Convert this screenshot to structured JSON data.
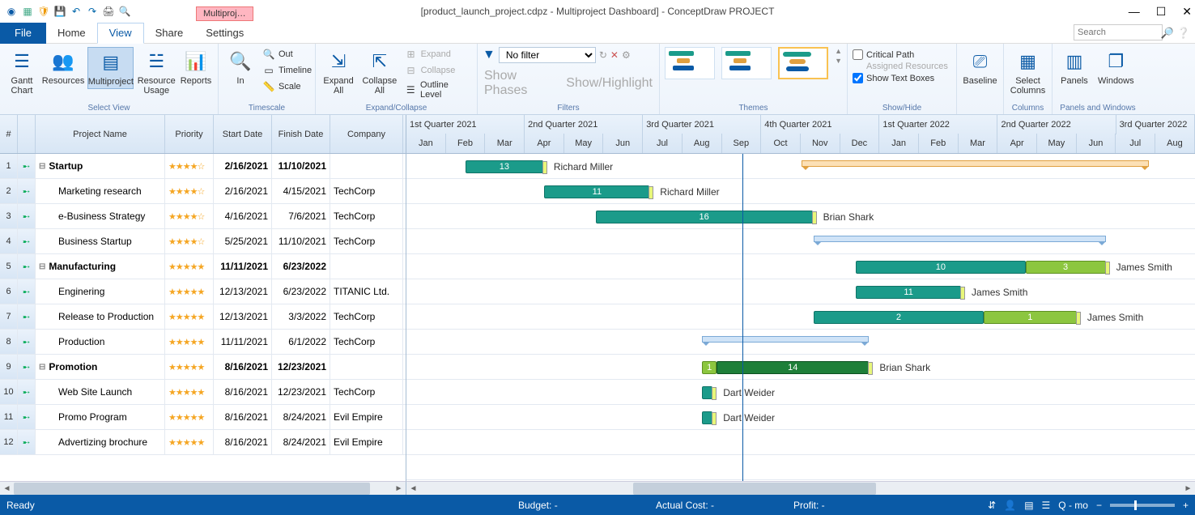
{
  "window": {
    "title": "[product_launch_project.cdpz - Multiproject Dashboard] - ConceptDraw PROJECT",
    "doc_tab": "Multiproj…"
  },
  "menu": {
    "file": "File",
    "home": "Home",
    "view": "View",
    "share": "Share",
    "settings": "Settings"
  },
  "search": {
    "placeholder": "Search"
  },
  "ribbon": {
    "groups": {
      "select_view": "Select View",
      "timescale": "Timescale",
      "expand_collapse": "Expand/Collapse",
      "filters": "Filters",
      "themes": "Themes",
      "show_hide": "Show/Hide",
      "columns": "Columns",
      "panels_windows": "Panels and Windows"
    },
    "buttons": {
      "gantt_chart": "Gantt\nChart",
      "resources": "Resources",
      "multiproject": "Multiproject",
      "resource_usage": "Resource\nUsage",
      "reports": "Reports",
      "in": "In",
      "out": "Out",
      "timeline": "Timeline",
      "scale": "Scale",
      "expand_all": "Expand\nAll",
      "collapse_all": "Collapse\nAll",
      "expand": "Expand",
      "collapse": "Collapse",
      "outline_level": "Outline Level",
      "no_filter": "No filter",
      "show_phases": "Show Phases",
      "show_highlight": "Show/Highlight",
      "critical_path": "Critical Path",
      "assigned_resources": "Assigned Resources",
      "show_text_boxes": "Show Text Boxes",
      "baseline": "Baseline",
      "select_columns": "Select\nColumns",
      "panels": "Panels",
      "windows": "Windows"
    }
  },
  "grid": {
    "headers": {
      "num": "#",
      "name": "Project Name",
      "priority": "Priority",
      "start": "Start Date",
      "finish": "Finish Date",
      "company": "Company"
    },
    "rows": [
      {
        "n": "1",
        "name": "Startup",
        "group": true,
        "indent": 0,
        "stars": 4,
        "start": "2/16/2021",
        "finish": "11/10/2021",
        "company": "",
        "bold": true
      },
      {
        "n": "2",
        "name": "Marketing research",
        "group": false,
        "indent": 1,
        "stars": 4,
        "start": "2/16/2021",
        "finish": "4/15/2021",
        "company": "TechCorp"
      },
      {
        "n": "3",
        "name": "e-Business Strategy",
        "group": false,
        "indent": 1,
        "stars": 4,
        "start": "4/16/2021",
        "finish": "7/6/2021",
        "company": "TechCorp"
      },
      {
        "n": "4",
        "name": "Business Startup",
        "group": false,
        "indent": 1,
        "stars": 4,
        "start": "5/25/2021",
        "finish": "11/10/2021",
        "company": "TechCorp"
      },
      {
        "n": "5",
        "name": "Manufacturing",
        "group": true,
        "indent": 0,
        "stars": 5,
        "start": "11/11/2021",
        "finish": "6/23/2022",
        "company": "",
        "bold": true
      },
      {
        "n": "6",
        "name": "Enginering",
        "group": false,
        "indent": 1,
        "stars": 5,
        "start": "12/13/2021",
        "finish": "6/23/2022",
        "company": "TITANIC Ltd."
      },
      {
        "n": "7",
        "name": "Release to Production",
        "group": false,
        "indent": 1,
        "stars": 5,
        "start": "12/13/2021",
        "finish": "3/3/2022",
        "company": "TechCorp"
      },
      {
        "n": "8",
        "name": "Production",
        "group": false,
        "indent": 1,
        "stars": 5,
        "start": "11/11/2021",
        "finish": "6/1/2022",
        "company": "TechCorp"
      },
      {
        "n": "9",
        "name": "Promotion",
        "group": true,
        "indent": 0,
        "stars": 5,
        "start": "8/16/2021",
        "finish": "12/23/2021",
        "company": "",
        "bold": true
      },
      {
        "n": "10",
        "name": "Web Site Launch",
        "group": false,
        "indent": 1,
        "stars": 5,
        "start": "8/16/2021",
        "finish": "12/23/2021",
        "company": "TechCorp"
      },
      {
        "n": "11",
        "name": "Promo Program",
        "group": false,
        "indent": 1,
        "stars": 5,
        "start": "8/16/2021",
        "finish": "8/24/2021",
        "company": "Evil Empire"
      },
      {
        "n": "12",
        "name": "Advertizing brochure",
        "group": false,
        "indent": 1,
        "stars": 5,
        "start": "8/16/2021",
        "finish": "8/24/2021",
        "company": "Evil Empire"
      }
    ]
  },
  "timeline": {
    "quarters": [
      "1st Quarter 2021",
      "2nd Quarter 2021",
      "3rd Quarter 2021",
      "4th Quarter 2021",
      "1st Quarter 2022",
      "2nd Quarter 2022",
      "3rd Quarter 2022"
    ],
    "months": [
      "Jan",
      "Feb",
      "Mar",
      "Apr",
      "May",
      "Jun",
      "Jul",
      "Aug",
      "Sep",
      "Oct",
      "Nov",
      "Dec",
      "Jan",
      "Feb",
      "Mar",
      "Apr",
      "May",
      "Jun",
      "Jul",
      "Aug"
    ]
  },
  "gantt_labels": {
    "r2": {
      "resource": "Richard Miller",
      "val": "13"
    },
    "r3": {
      "resource": "Richard Miller",
      "val": "11"
    },
    "r4": {
      "resource": "Brian Shark",
      "val": "16"
    },
    "r6": {
      "resource": "James Smith",
      "val1": "10",
      "val2": "3"
    },
    "r7": {
      "resource": "James Smith",
      "val": "11"
    },
    "r8": {
      "resource": "James Smith",
      "val1": "2",
      "val2": "1"
    },
    "r10": {
      "resource": "Brian Shark",
      "val1": "1",
      "val2": "14"
    },
    "r11": {
      "resource": "Dart Weider"
    },
    "r12": {
      "resource": "Dart Weider"
    }
  },
  "status": {
    "ready": "Ready",
    "budget": "Budget: -",
    "actual": "Actual Cost: -",
    "profit": "Profit: -",
    "zoom": "Q - mo"
  }
}
